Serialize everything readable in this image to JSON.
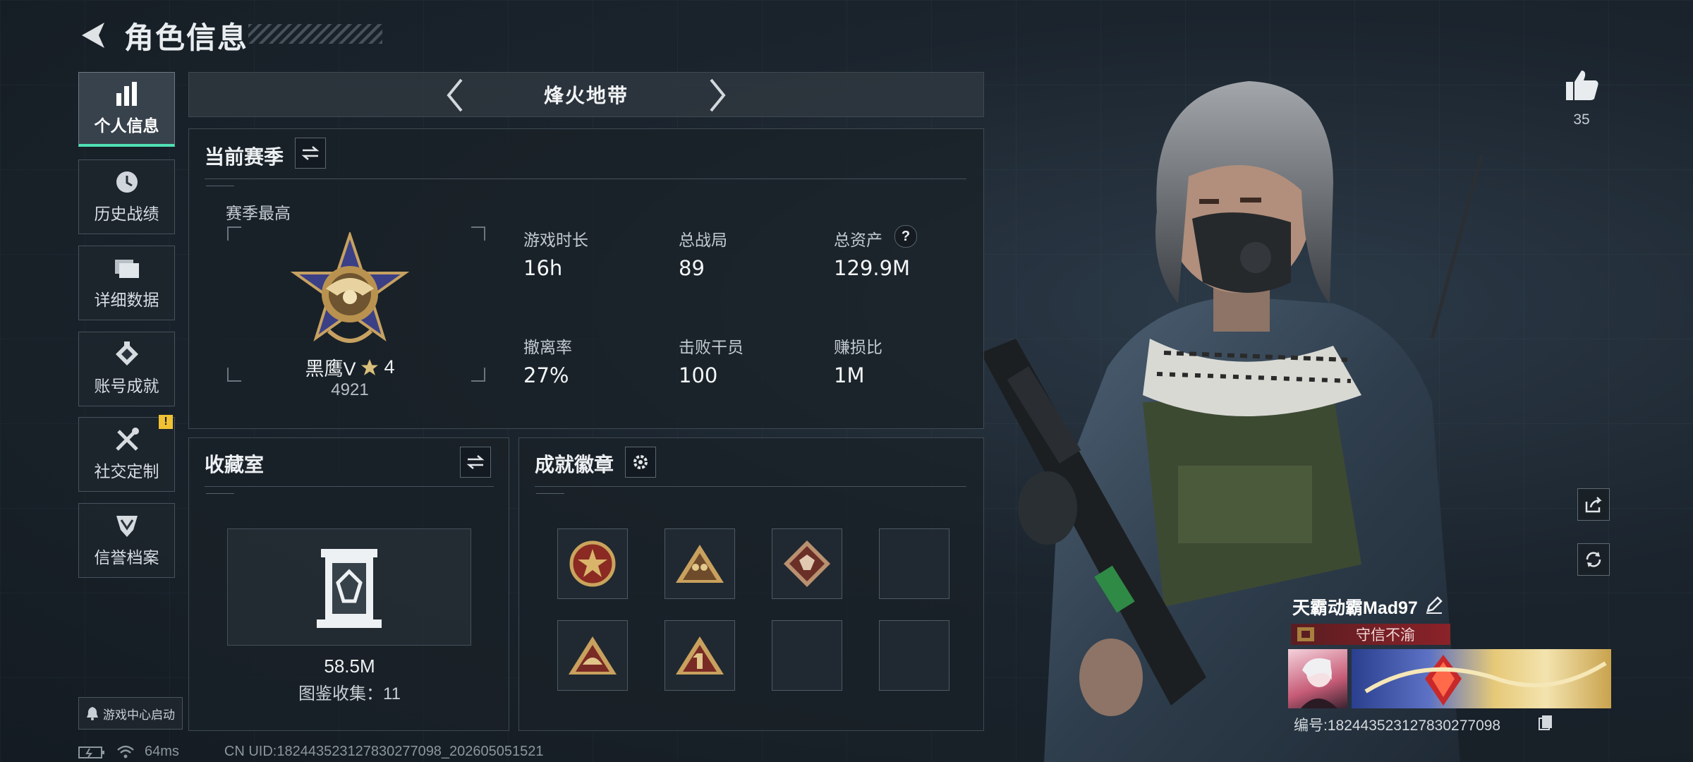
{
  "header": {
    "title": "角色信息"
  },
  "sidebar": {
    "items": [
      {
        "label": "个人信息",
        "icon": "bar-chart-icon",
        "active": true
      },
      {
        "label": "历史战绩",
        "icon": "history-clock-icon",
        "active": false
      },
      {
        "label": "详细数据",
        "icon": "folder-icon",
        "active": false
      },
      {
        "label": "账号成就",
        "icon": "achievement-icon",
        "active": false
      },
      {
        "label": "社交定制",
        "icon": "tools-icon",
        "active": false,
        "badge": "!"
      },
      {
        "label": "信誉档案",
        "icon": "credit-shield-icon",
        "active": false
      }
    ],
    "launch_label": "游戏中心启动"
  },
  "mode": {
    "name": "烽火地带"
  },
  "season": {
    "title": "当前赛季",
    "best_label": "赛季最高",
    "rank_name": "黑鹰V",
    "rank_stars": "4",
    "rank_points": "4921",
    "stats": [
      {
        "label": "游戏时长",
        "value": "16h"
      },
      {
        "label": "总战局",
        "value": "89"
      },
      {
        "label": "总资产",
        "value": "129.9M",
        "help": "?"
      },
      {
        "label": "撤离率",
        "value": "27%"
      },
      {
        "label": "击败干员",
        "value": "100"
      },
      {
        "label": "赚损比",
        "value": "1M"
      }
    ]
  },
  "collection": {
    "title": "收藏室",
    "value": "58.5M",
    "catalog_label": "图鉴收集：",
    "catalog_count": "11"
  },
  "badges": {
    "title": "成就徽章",
    "slots": [
      {
        "name": "star-medal-badge",
        "filled": true
      },
      {
        "name": "soldiers-triangle-badge",
        "filled": true
      },
      {
        "name": "wolf-diamond-badge",
        "filled": true
      },
      {
        "name": "empty",
        "filled": false
      },
      {
        "name": "helmet-triangle-badge",
        "filled": true
      },
      {
        "name": "number-one-triangle-badge",
        "filled": true
      },
      {
        "name": "empty",
        "filled": false
      },
      {
        "name": "empty",
        "filled": false
      }
    ]
  },
  "profile": {
    "likes": "35",
    "player_name": "天霸动霸Mad97",
    "title_tag": "守信不渝",
    "id_label": "编号:",
    "id_value": "1824435231278302770​98"
  },
  "status": {
    "ping": "64ms",
    "uid": "CN UID:1824435231278302770​98_202605051521"
  },
  "colors": {
    "accent": "#4fe0b4",
    "badge_yellow": "#f0c233",
    "title_red": "#8a2229"
  }
}
